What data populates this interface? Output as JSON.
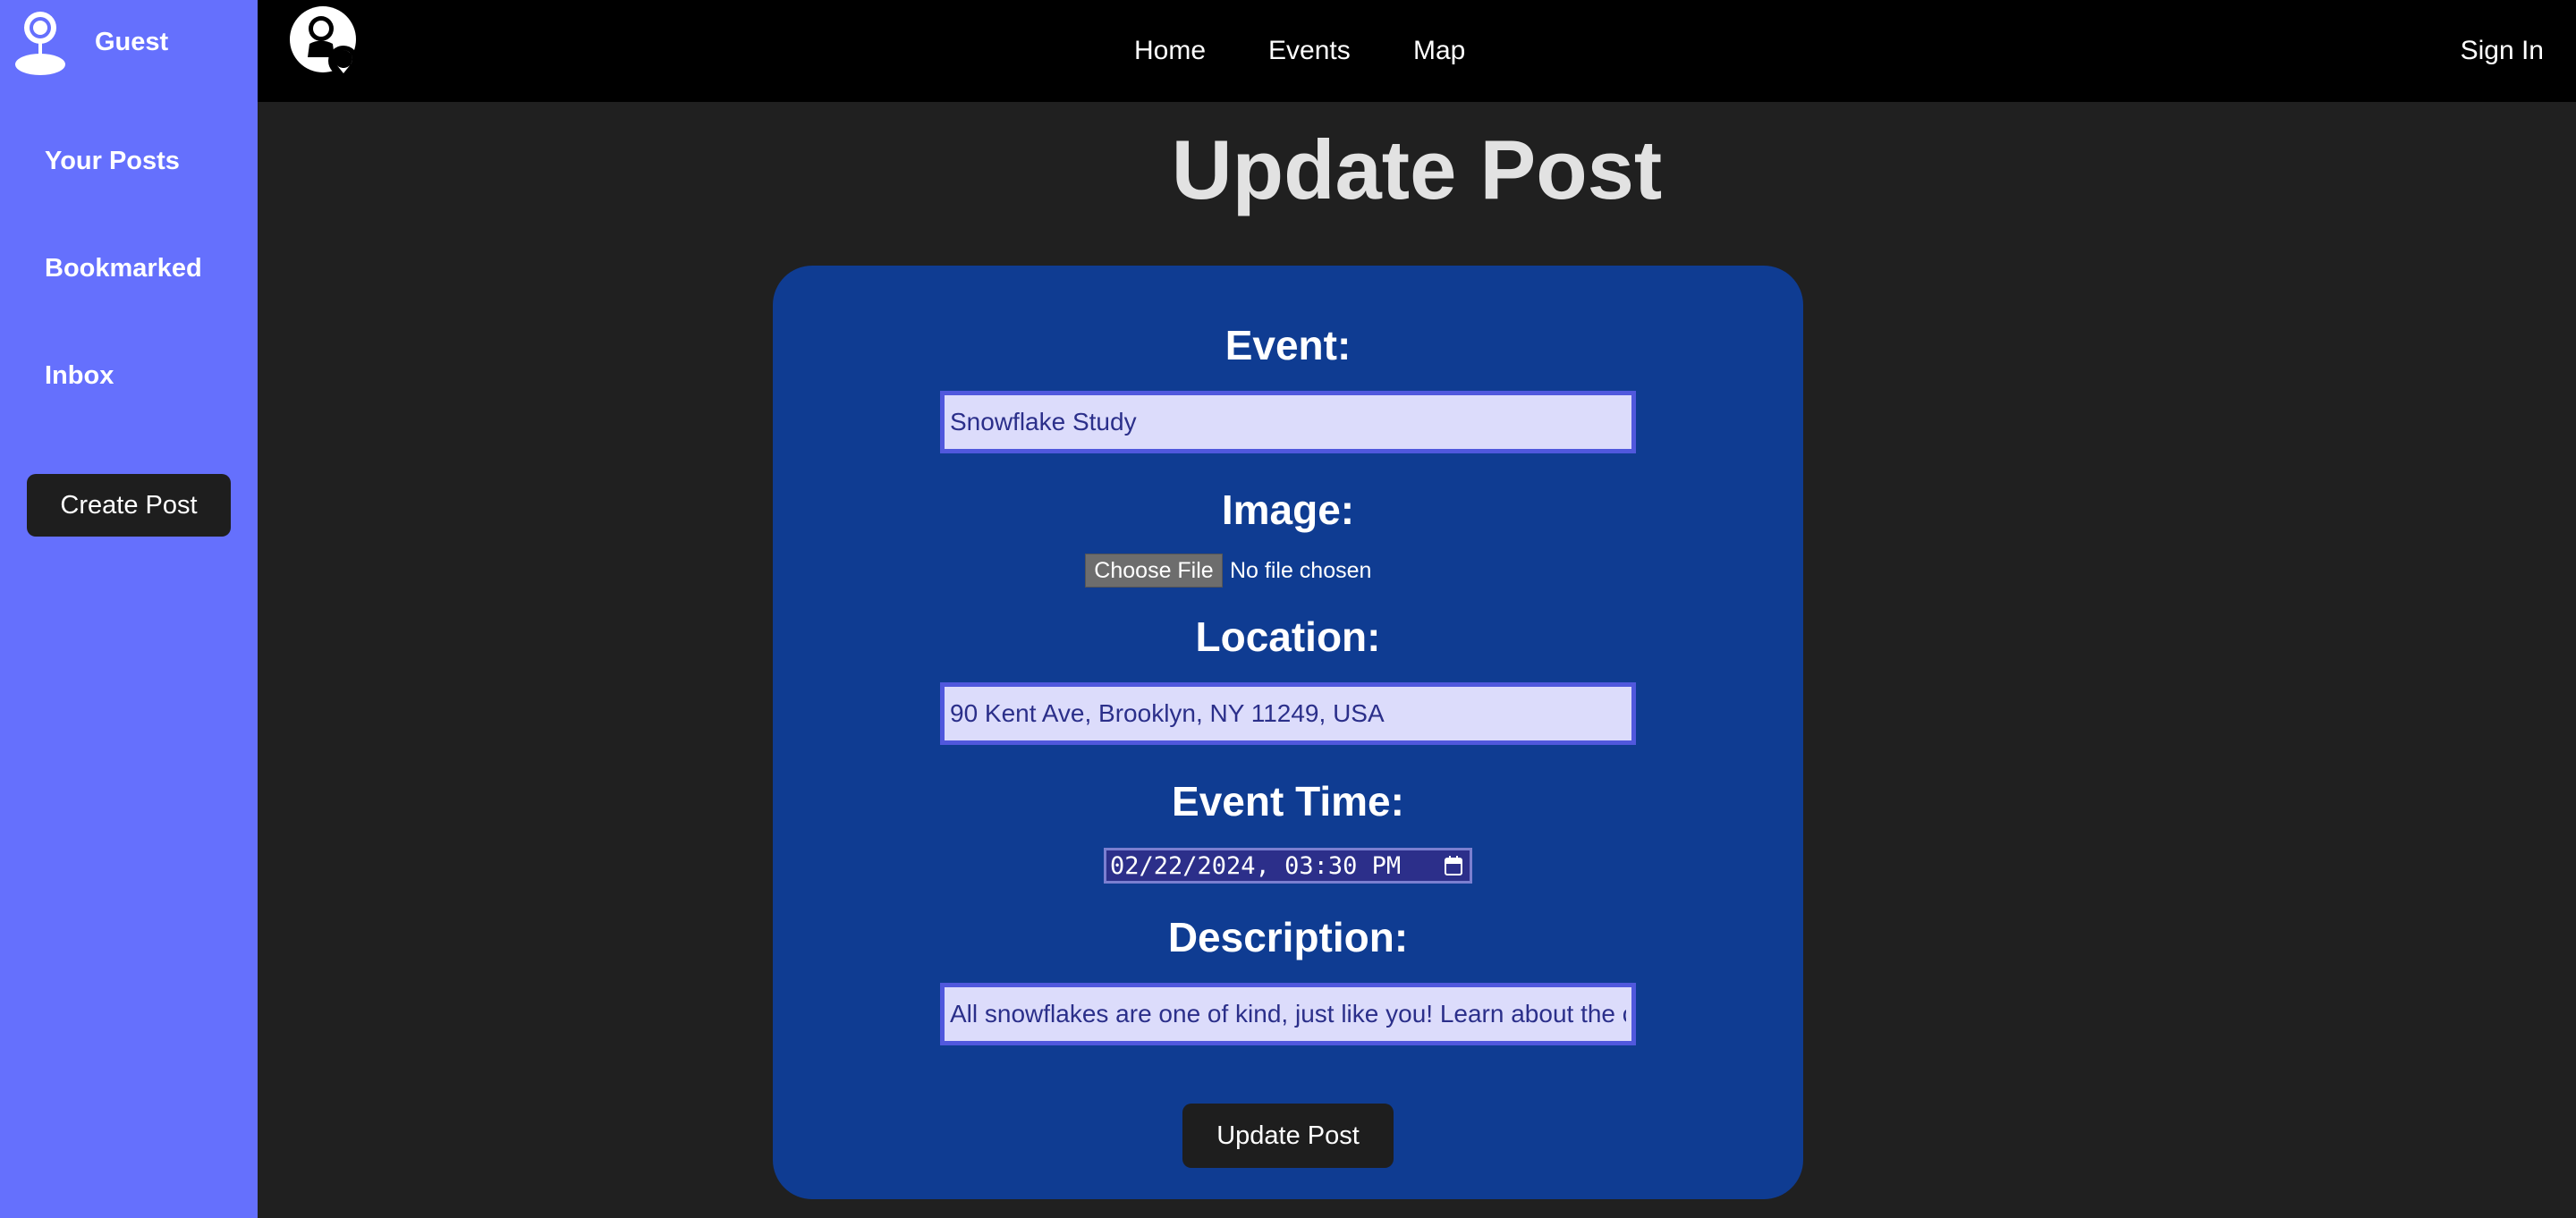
{
  "sidebar": {
    "user_name": "Guest",
    "items": [
      {
        "label": "Your Posts"
      },
      {
        "label": "Bookmarked"
      },
      {
        "label": "Inbox"
      }
    ],
    "create_label": "Create Post"
  },
  "nav": {
    "links": [
      {
        "label": "Home"
      },
      {
        "label": "Events"
      },
      {
        "label": "Map"
      }
    ],
    "signin_label": "Sign In"
  },
  "page": {
    "title": "Update Post"
  },
  "form": {
    "event_label": "Event:",
    "event_value": "Snowflake Study",
    "image_label": "Image:",
    "file_button": "Choose File",
    "file_status": "No file chosen",
    "location_label": "Location:",
    "location_value": "90 Kent Ave, Brooklyn, NY 11249, USA",
    "time_label": "Event Time:",
    "time_value": "02/22/2024, 03:30 PM",
    "description_label": "Description:",
    "description_value": "All snowflakes are one of kind, just like you! Learn about the chemistry of snowflakes",
    "submit_label": "Update Post"
  },
  "colors": {
    "sidebar": "#6570fd",
    "card": "#0f3c92",
    "topbar": "#000000",
    "background": "#202020"
  }
}
